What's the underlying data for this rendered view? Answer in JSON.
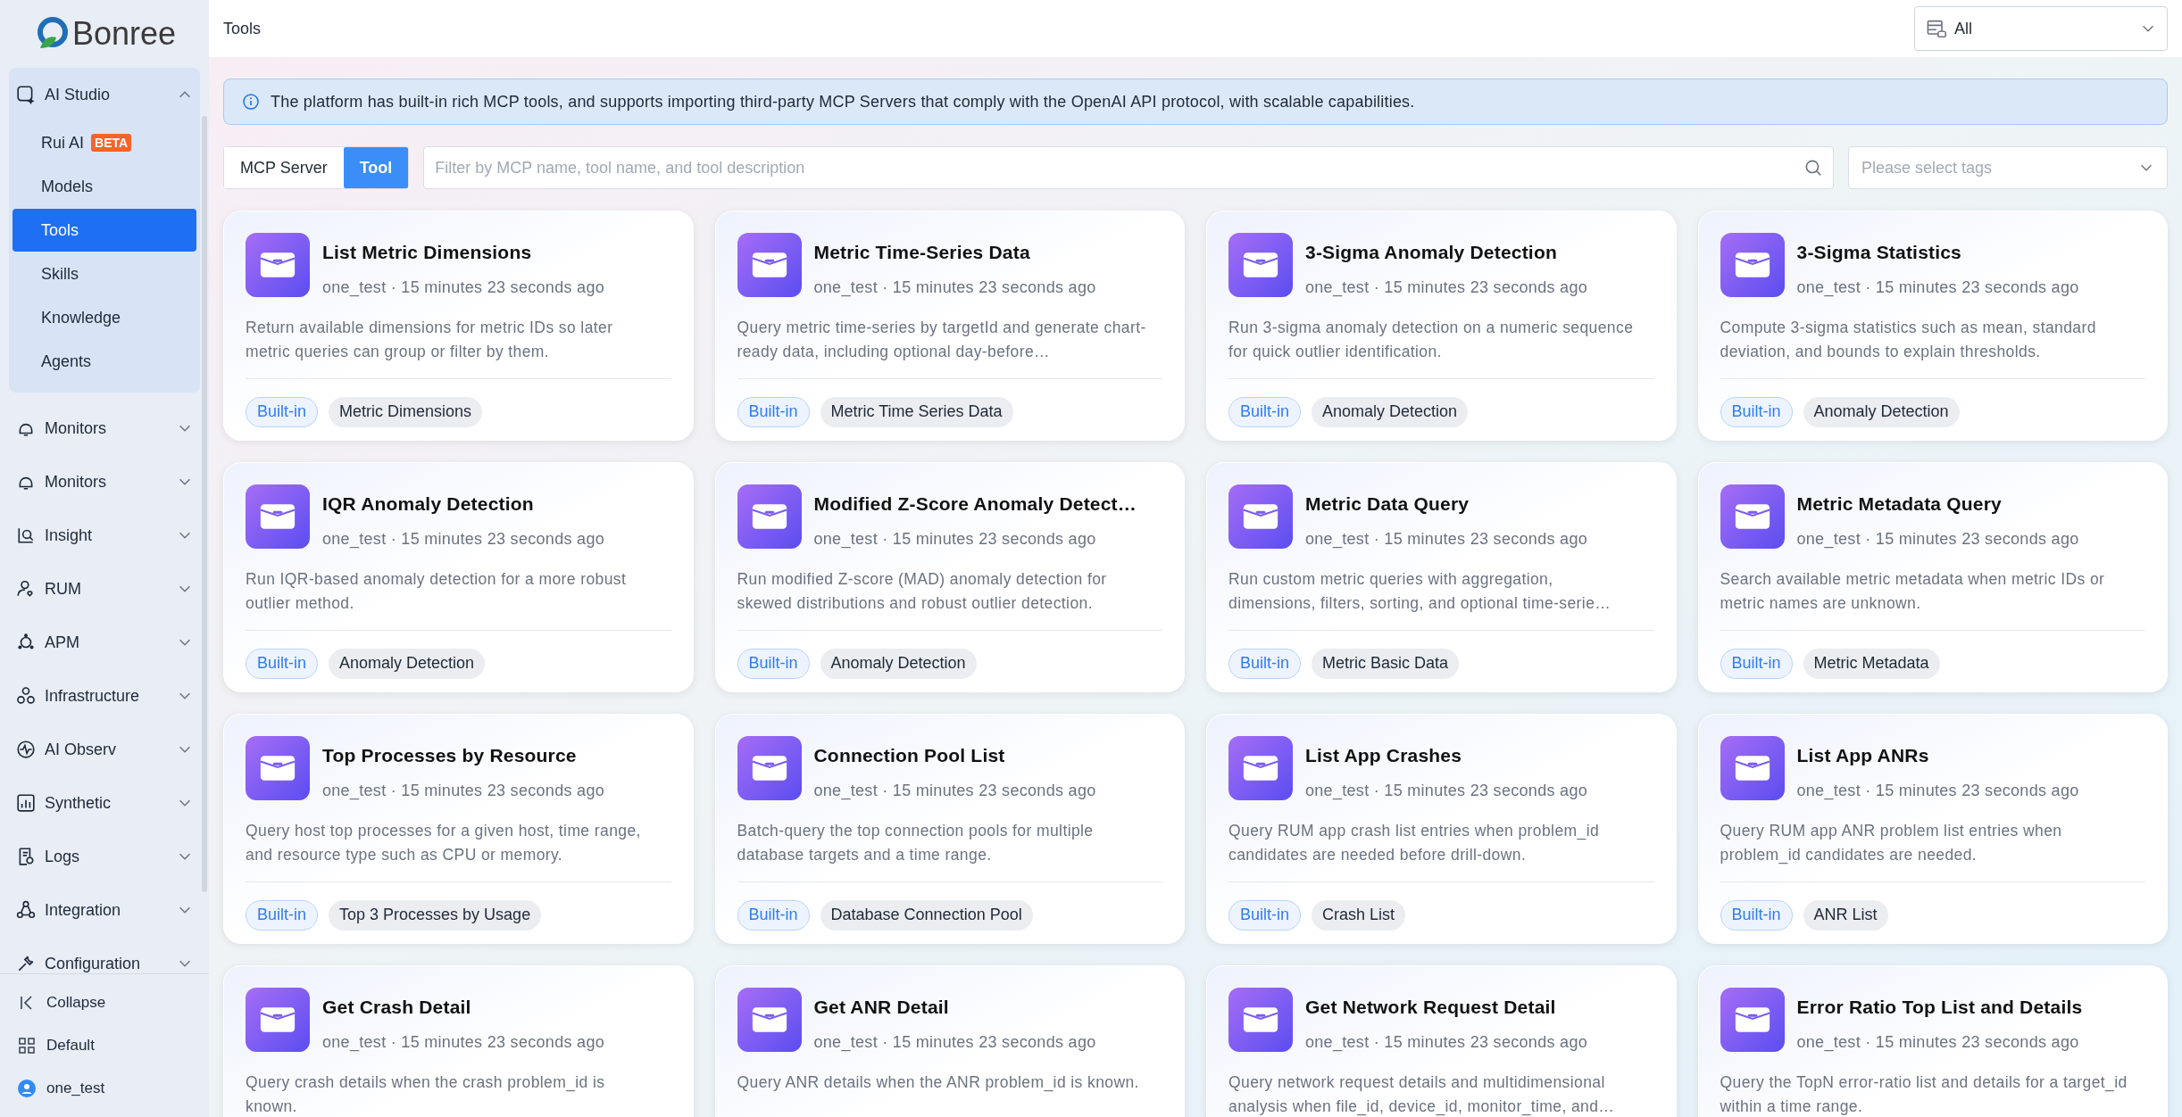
{
  "brand": {
    "name": "Bonree"
  },
  "sidebar": {
    "items": [
      {
        "label": "AI Studio",
        "expanded": true,
        "children": [
          {
            "label": "Rui AI",
            "badge": "BETA",
            "selected": false
          },
          {
            "label": "Models",
            "selected": false
          },
          {
            "label": "Tools",
            "selected": true
          },
          {
            "label": "Skills",
            "selected": false
          },
          {
            "label": "Knowledge",
            "selected": false
          },
          {
            "label": "Agents",
            "selected": false
          }
        ]
      },
      {
        "label": "Monitors",
        "expanded": false
      },
      {
        "label": "Monitors",
        "expanded": false
      },
      {
        "label": "Insight",
        "expanded": false
      },
      {
        "label": "RUM",
        "expanded": false
      },
      {
        "label": "APM",
        "expanded": false
      },
      {
        "label": "Infrastructure",
        "expanded": false
      },
      {
        "label": "AI Observ",
        "expanded": false
      },
      {
        "label": "Synthetic",
        "expanded": false
      },
      {
        "label": "Logs",
        "expanded": false
      },
      {
        "label": "Integration",
        "expanded": false
      },
      {
        "label": "Configuration",
        "expanded": false
      }
    ],
    "footer": [
      {
        "label": "Collapse"
      },
      {
        "label": "Default"
      },
      {
        "label": "one_test"
      }
    ]
  },
  "header": {
    "title": "Tools",
    "scope_select": {
      "value": "All"
    }
  },
  "info_banner": "The platform has built-in rich MCP tools, and supports importing third-party MCP Servers that comply with the OpenAI API protocol, with scalable capabilities.",
  "tabs": [
    {
      "label": "MCP Server",
      "selected": false
    },
    {
      "label": "Tool",
      "selected": true
    }
  ],
  "search": {
    "placeholder": "Filter by MCP name, tool name, and tool description"
  },
  "tag_select": {
    "placeholder": "Please select tags"
  },
  "cards": [
    {
      "title": "List Metric Dimensions",
      "meta": "one_test · 15 minutes 23 seconds ago",
      "description": "Return available dimensions for metric IDs so later metric queries can group or filter by them.",
      "tags": [
        "Built-in",
        "Metric Dimensions"
      ]
    },
    {
      "title": "Metric Time-Series Data",
      "meta": "one_test · 15 minutes 23 seconds ago",
      "description": "Query metric time-series by targetId and generate chart-ready data, including optional day-before…",
      "tags": [
        "Built-in",
        "Metric Time Series Data"
      ]
    },
    {
      "title": "3-Sigma Anomaly Detection",
      "meta": "one_test · 15 minutes 23 seconds ago",
      "description": "Run 3-sigma anomaly detection on a numeric sequence for quick outlier identification.",
      "tags": [
        "Built-in",
        "Anomaly Detection"
      ]
    },
    {
      "title": "3-Sigma Statistics",
      "meta": "one_test · 15 minutes 23 seconds ago",
      "description": "Compute 3-sigma statistics such as mean, standard deviation, and bounds to explain thresholds.",
      "tags": [
        "Built-in",
        "Anomaly Detection"
      ]
    },
    {
      "title": "IQR Anomaly Detection",
      "meta": "one_test · 15 minutes 23 seconds ago",
      "description": "Run IQR-based anomaly detection for a more robust outlier method.",
      "tags": [
        "Built-in",
        "Anomaly Detection"
      ]
    },
    {
      "title": "Modified Z-Score Anomaly Detect…",
      "meta": "one_test · 15 minutes 23 seconds ago",
      "description": "Run modified Z-score (MAD) anomaly detection for skewed distributions and robust outlier detection.",
      "tags": [
        "Built-in",
        "Anomaly Detection"
      ]
    },
    {
      "title": "Metric Data Query",
      "meta": "one_test · 15 minutes 23 seconds ago",
      "description": "Run custom metric queries with aggregation, dimensions, filters, sorting, and optional time-serie…",
      "tags": [
        "Built-in",
        "Metric Basic Data"
      ]
    },
    {
      "title": "Metric Metadata Query",
      "meta": "one_test · 15 minutes 23 seconds ago",
      "description": "Search available metric metadata when metric IDs or metric names are unknown.",
      "tags": [
        "Built-in",
        "Metric Metadata"
      ]
    },
    {
      "title": "Top Processes by Resource",
      "meta": "one_test · 15 minutes 23 seconds ago",
      "description": "Query host top processes for a given host, time range, and resource type such as CPU or memory.",
      "tags": [
        "Built-in",
        "Top 3 Processes by Usage"
      ]
    },
    {
      "title": "Connection Pool List",
      "meta": "one_test · 15 minutes 23 seconds ago",
      "description": "Batch-query the top connection pools for multiple database targets and a time range.",
      "tags": [
        "Built-in",
        "Database Connection Pool"
      ]
    },
    {
      "title": "List App Crashes",
      "meta": "one_test · 15 minutes 23 seconds ago",
      "description": "Query RUM app crash list entries when problem_id candidates are needed before drill-down.",
      "tags": [
        "Built-in",
        "Crash List"
      ]
    },
    {
      "title": "List App ANRs",
      "meta": "one_test · 15 minutes 23 seconds ago",
      "description": "Query RUM app ANR problem list entries when problem_id candidates are needed.",
      "tags": [
        "Built-in",
        "ANR List"
      ]
    },
    {
      "title": "Get Crash Detail",
      "meta": "one_test · 15 minutes 23 seconds ago",
      "description": "Query crash details when the crash problem_id is known."
    },
    {
      "title": "Get ANR Detail",
      "meta": "one_test · 15 minutes 23 seconds ago",
      "description": "Query ANR details when the ANR problem_id is known."
    },
    {
      "title": "Get Network Request Detail",
      "meta": "one_test · 15 minutes 23 seconds ago",
      "description": "Query network request details and multidimensional analysis when file_id, device_id, monitor_time, and…"
    },
    {
      "title": "Error Ratio Top List and Details",
      "meta": "one_test · 15 minutes 23 seconds ago",
      "description": "Query the TopN error-ratio list and details for a target_id within a time range."
    }
  ]
}
